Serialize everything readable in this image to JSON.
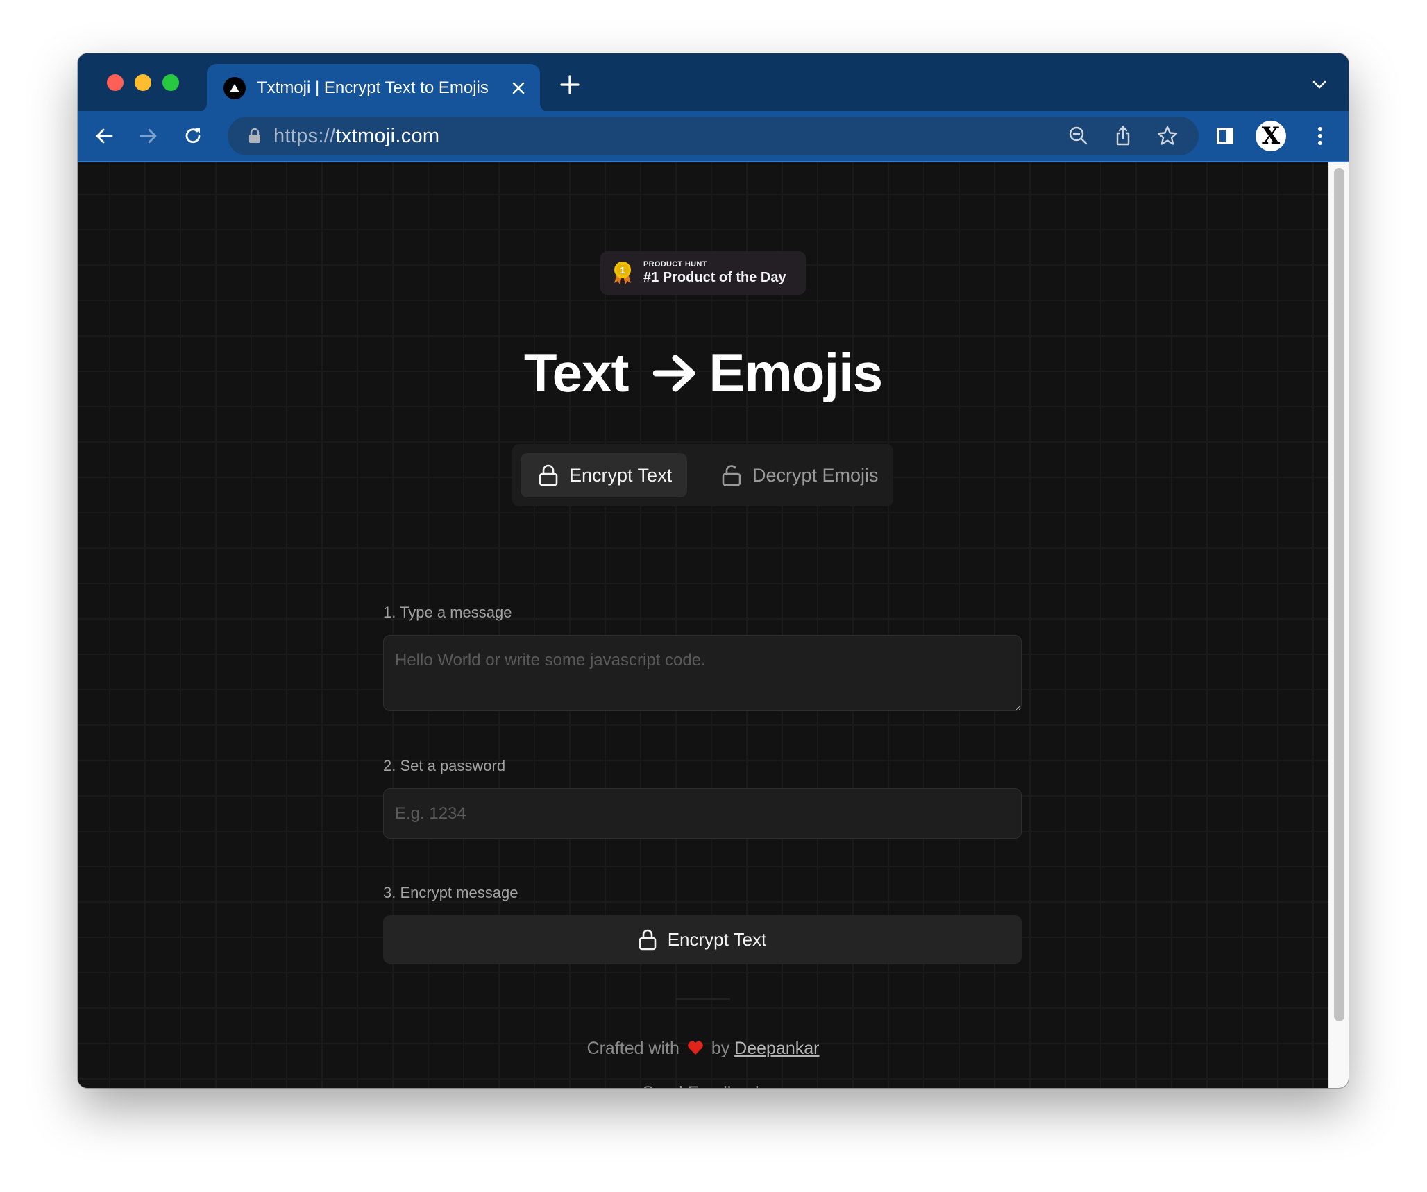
{
  "browser": {
    "tab": {
      "favicon": "triangle-logo-icon",
      "title": "Txtmoji | Encrypt Text to Emojis"
    },
    "url": {
      "scheme": "https://",
      "host": "txtmoji.com"
    },
    "toolbar_icons": [
      "back-icon",
      "forward-icon",
      "reload-icon",
      "lock-icon",
      "zoom-out-icon",
      "share-icon",
      "star-icon",
      "sidebar-icon",
      "profile-avatar",
      "more-vert-icon"
    ],
    "profile_initial": "X"
  },
  "page": {
    "badge": {
      "kicker": "PRODUCT HUNT",
      "title": "#1 Product of the Day",
      "icon": "medal-icon"
    },
    "heading": {
      "left": "Text",
      "arrow": "arrow-right-icon",
      "right": "Emojis"
    },
    "mode_tabs": [
      {
        "label": "Encrypt Text",
        "icon": "lock-icon",
        "active": true
      },
      {
        "label": "Decrypt Emojis",
        "icon": "unlock-icon",
        "active": false
      }
    ],
    "form": {
      "message_label": "1. Type a message",
      "message_value": "",
      "message_placeholder": "Hello World or write some javascript code.",
      "password_label": "2. Set a password",
      "password_value": "",
      "password_placeholder": "E.g. 1234",
      "encrypt_label": "3. Encrypt message",
      "encrypt_button": "Encrypt Text"
    },
    "footer": {
      "crafted_prefix": "Crafted with",
      "heart": "heart-emoji",
      "crafted_by": "by",
      "author": "Deepankar",
      "feedback": "Send Feedback"
    }
  },
  "colors": {
    "titlebar": "#0d3561",
    "toolbar": "#15539a",
    "omnibox": "#1a4577",
    "page_bg": "#121212",
    "badge_bg": "#241f24",
    "accent_medal": "#f2c200"
  }
}
